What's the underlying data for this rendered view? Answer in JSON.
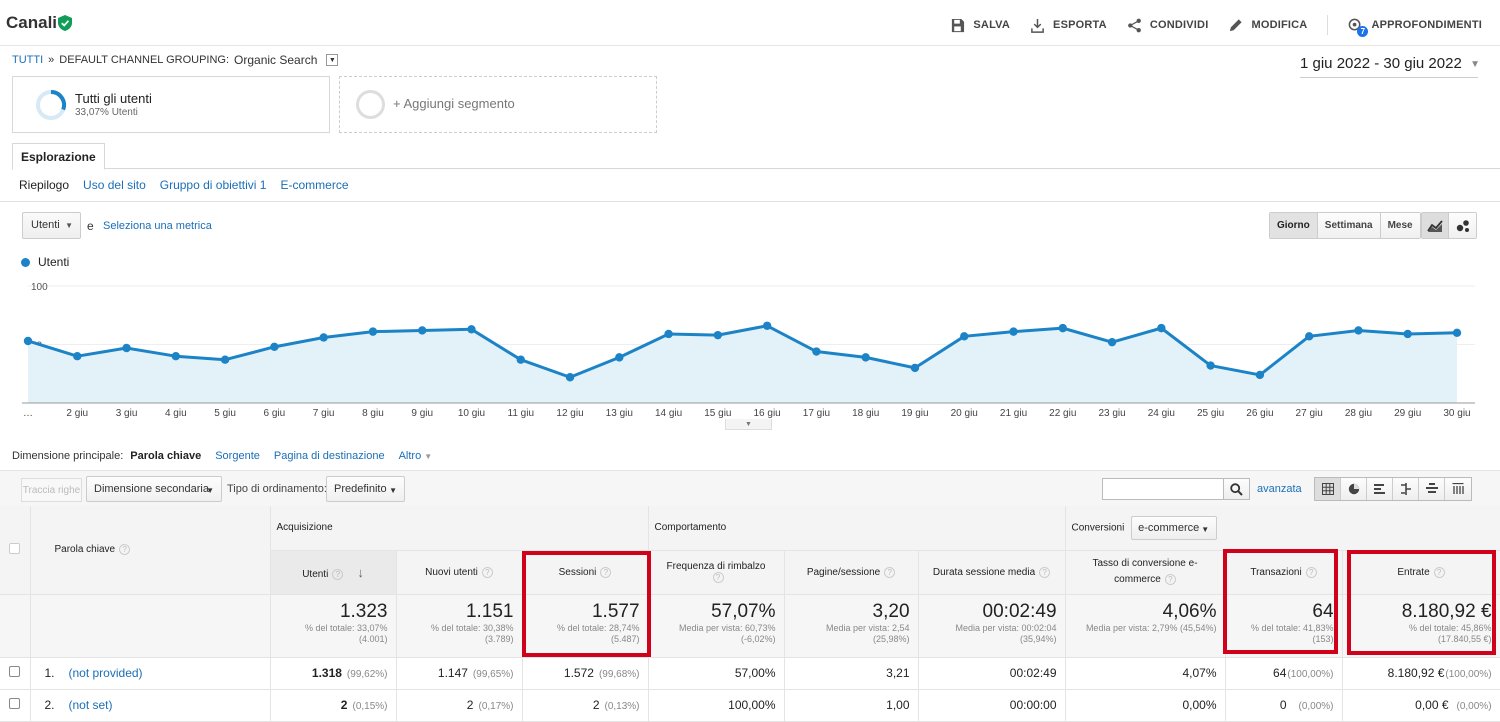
{
  "header": {
    "title": "Canali",
    "actions": {
      "save": "SALVA",
      "export": "ESPORTA",
      "share": "CONDIVIDI",
      "edit": "MODIFICA",
      "insights": "APPROFONDIMENTI",
      "insights_badge": "7"
    }
  },
  "breadcrumb": {
    "all": "TUTTI",
    "separator": "»",
    "grouping": "DEFAULT CHANNEL GROUPING:",
    "value": "Organic Search"
  },
  "date_range": "1 giu 2022 - 30 giu 2022",
  "segments": {
    "current_name": "Tutti gli utenti",
    "current_sub": "33,07% Utenti",
    "add_label": "+ Aggiungi segmento"
  },
  "tabs": {
    "active": "Esplorazione"
  },
  "subnav": {
    "summary": "Riepilogo",
    "site_usage": "Uso del sito",
    "goals": "Gruppo di obiettivi 1",
    "ecommerce": "E-commerce"
  },
  "chart_controls": {
    "metric": "Utenti",
    "and": "e",
    "select_metric": "Seleziona una metrica",
    "periods": [
      "Giorno",
      "Settimana",
      "Mese"
    ],
    "active_period": "Giorno"
  },
  "colors": {
    "accent": "#1c84c6",
    "area_fill": "#e3f1f9",
    "highlight": "#d0021b",
    "link": "#1a6fb8"
  },
  "chart_data": {
    "type": "area",
    "series": [
      {
        "name": "Utenti",
        "values": [
          53,
          40,
          47,
          40,
          37,
          48,
          56,
          61,
          62,
          63,
          37,
          22,
          39,
          59,
          58,
          66,
          44,
          39,
          30,
          57,
          61,
          64,
          52,
          64,
          32,
          24,
          57,
          62,
          59,
          60
        ]
      }
    ],
    "x_labels": [
      "…",
      "2 giu",
      "3 giu",
      "4 giu",
      "5 giu",
      "6 giu",
      "7 giu",
      "8 giu",
      "9 giu",
      "10 giu",
      "11 giu",
      "12 giu",
      "13 giu",
      "14 giu",
      "15 giu",
      "16 giu",
      "17 giu",
      "18 giu",
      "19 giu",
      "20 giu",
      "21 giu",
      "22 giu",
      "23 giu",
      "24 giu",
      "25 giu",
      "26 giu",
      "27 giu",
      "28 giu",
      "29 giu",
      "30 giu"
    ],
    "y_ticks": [
      "100",
      "50"
    ],
    "ylim": [
      0,
      100
    ]
  },
  "dimensions": {
    "label": "Dimensione principale:",
    "active": "Parola chiave",
    "source": "Sorgente",
    "landing": "Pagina di destinazione",
    "more": "Altro"
  },
  "toolbar": {
    "plot_rows": "Traccia righe",
    "secondary_dim": "Dimensione secondaria",
    "sort_label": "Tipo di ordinamento:",
    "sort_value": "Predefinito",
    "search_placeholder": "",
    "advanced": "avanzata"
  },
  "table": {
    "groups": {
      "acquisition": "Acquisizione",
      "behavior": "Comportamento",
      "conversions": "Conversioni",
      "conv_select": "e-commerce"
    },
    "columns": {
      "keyword": "Parola chiave",
      "users": "Utenti",
      "new_users": "Nuovi utenti",
      "sessions": "Sessioni",
      "bounce": "Frequenza di rimbalzo",
      "pages": "Pagine/sessione",
      "duration": "Durata sessione media",
      "conv_rate": "Tasso di conversione e-commerce",
      "transactions": "Transazioni",
      "revenue": "Entrate"
    },
    "totals": {
      "users": {
        "v": "1.323",
        "s1": "% del totale: 33,07%",
        "s2": "(4.001)"
      },
      "new_users": {
        "v": "1.151",
        "s1": "% del totale: 30,38%",
        "s2": "(3.789)"
      },
      "sessions": {
        "v": "1.577",
        "s1": "% del totale: 28,74%",
        "s2": "(5.487)"
      },
      "bounce": {
        "v": "57,07%",
        "s1": "Media per vista: 60,73%",
        "s2": "(-6,02%)"
      },
      "pages": {
        "v": "3,20",
        "s1": "Media per vista: 2,54",
        "s2": "(25,98%)"
      },
      "duration": {
        "v": "00:02:49",
        "s1": "Media per vista: 00:02:04",
        "s2": "(35,94%)"
      },
      "conv_rate": {
        "v": "4,06%",
        "s1": "Media per vista: 2,79% (45,54%)",
        "s2": ""
      },
      "transactions": {
        "v": "64",
        "s1": "% del totale: 41,83%",
        "s2": "(153)"
      },
      "revenue": {
        "v": "8.180,92 €",
        "s1": "% del totale: 45,86%",
        "s2": "(17.840,55 €)"
      }
    },
    "rows": [
      {
        "num": "1.",
        "keyword": "(not provided)",
        "users": "1.318",
        "users_pct": "(99,62%)",
        "new_users": "1.147",
        "new_users_pct": "(99,65%)",
        "sessions": "1.572",
        "sessions_pct": "(99,68%)",
        "bounce": "57,00%",
        "pages": "3,21",
        "duration": "00:02:49",
        "conv_rate": "4,07%",
        "transactions": "64",
        "transactions_pct": "(100,00%)",
        "revenue": "8.180,92 €",
        "revenue_pct": "(100,00%)"
      },
      {
        "num": "2.",
        "keyword": "(not set)",
        "users": "2",
        "users_pct": "(0,15%)",
        "new_users": "2",
        "new_users_pct": "(0,17%)",
        "sessions": "2",
        "sessions_pct": "(0,13%)",
        "bounce": "100,00%",
        "pages": "1,00",
        "duration": "00:00:00",
        "conv_rate": "0,00%",
        "transactions": "0",
        "transactions_pct": "(0,00%)",
        "revenue": "0,00 €",
        "revenue_pct": "(0,00%)"
      }
    ]
  }
}
